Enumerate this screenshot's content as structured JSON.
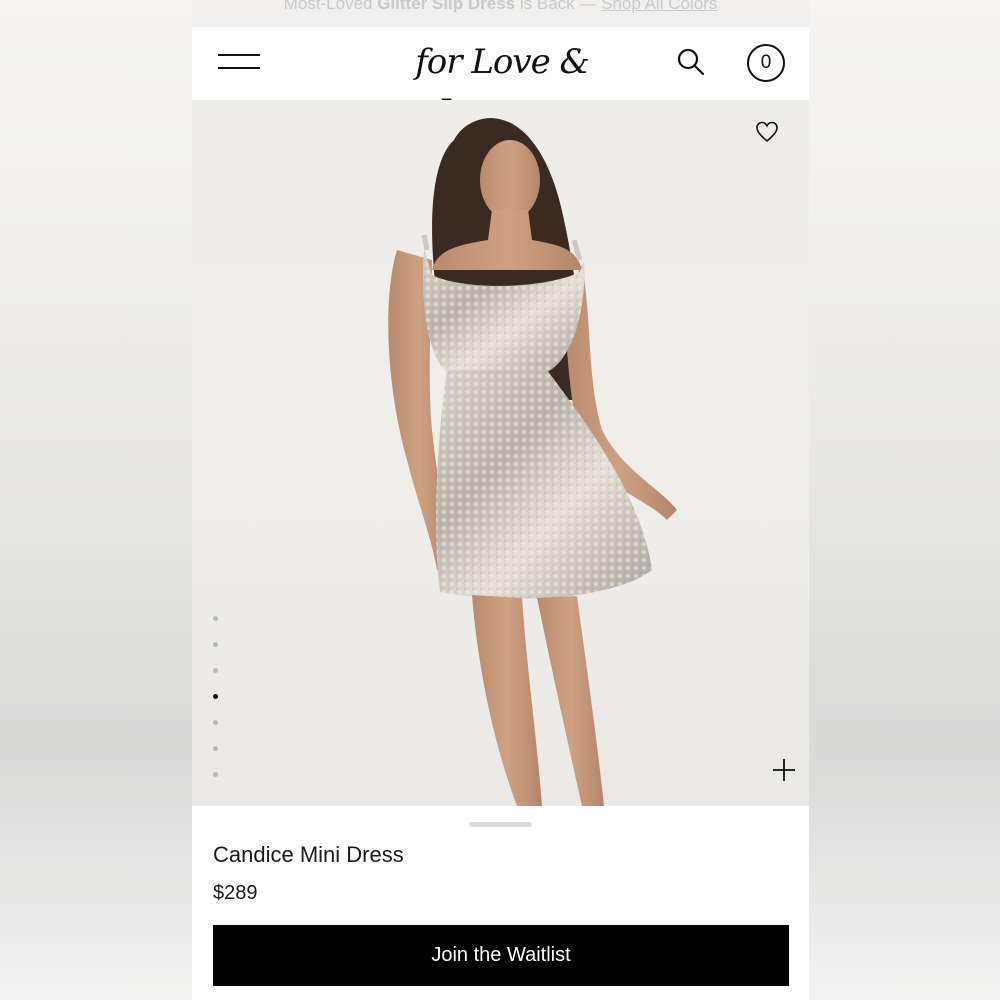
{
  "promo": {
    "prefix": "Most-Loved ",
    "highlight": "Glitter Slip Dress",
    "middle": " is Back — ",
    "link": "Shop All Colors"
  },
  "header": {
    "logo": "for Love & Lemons",
    "cart_count": "0"
  },
  "gallery": {
    "slides": 7,
    "active_slide": 4,
    "image_description_icon": "model-photo"
  },
  "product": {
    "title": "Candice Mini Dress",
    "price": "$289",
    "cta_label": "Join the Waitlist"
  },
  "colors": {
    "button_bg": "#000000",
    "button_text": "#ffffff",
    "page_bg": "#ffffff"
  }
}
